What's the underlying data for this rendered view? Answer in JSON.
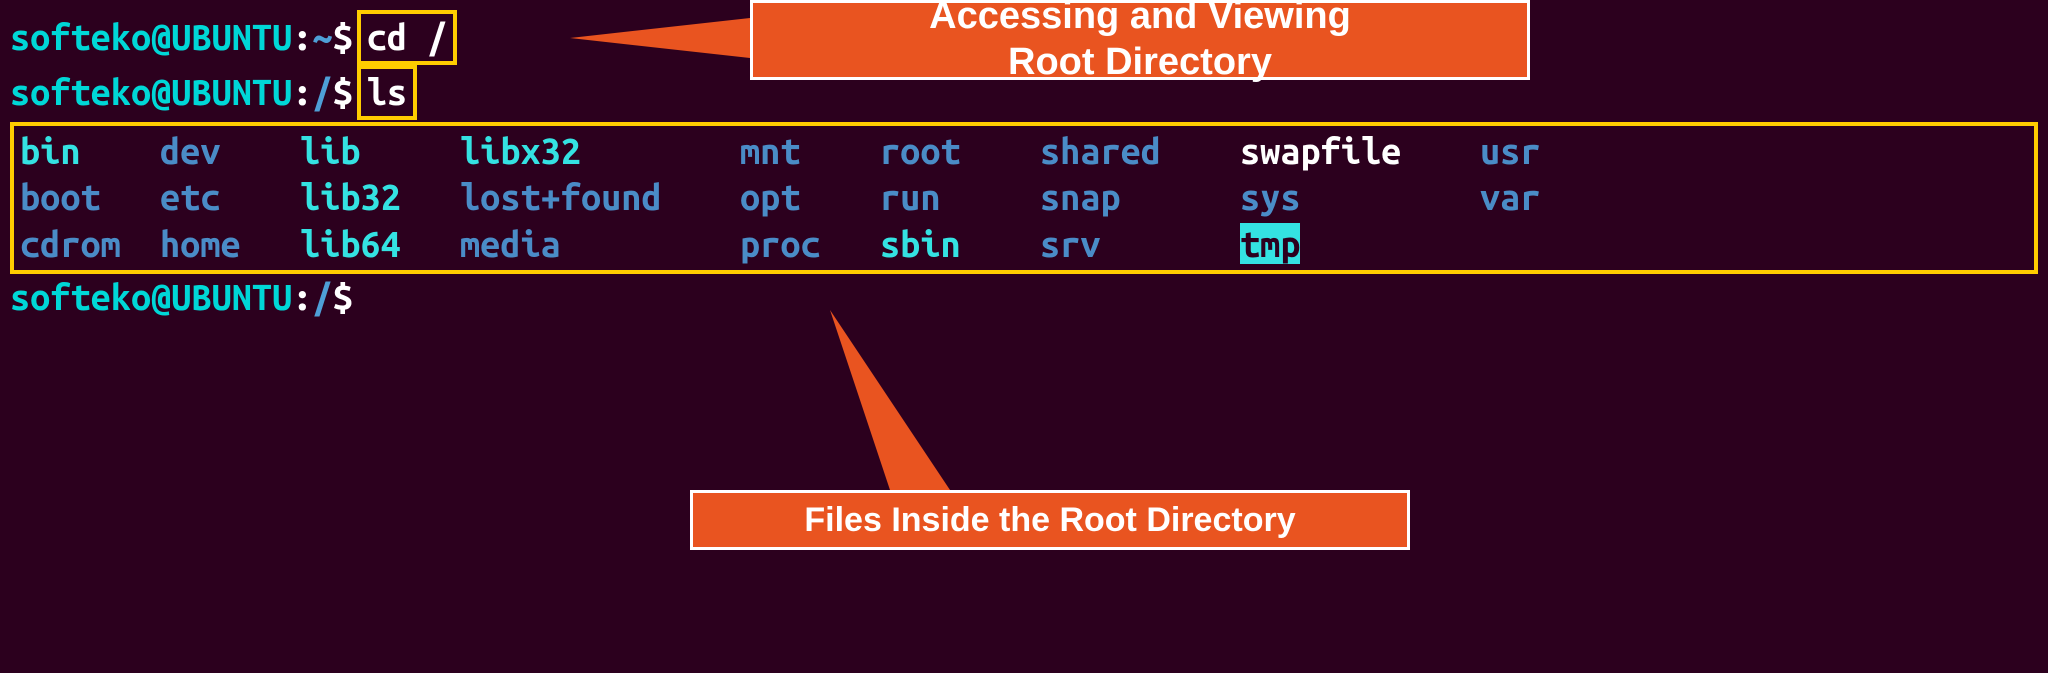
{
  "prompts": {
    "line1": {
      "user_host": "softeko@UBUNTU",
      "colon": ":",
      "path": "~",
      "dollar": "$ ",
      "command": "cd /"
    },
    "line2": {
      "user_host": "softeko@UBUNTU",
      "colon": ":",
      "path": "/",
      "dollar": "$ ",
      "command": "ls"
    },
    "line3": {
      "user_host": "softeko@UBUNTU",
      "colon": ":",
      "path": "/",
      "dollar": "$"
    }
  },
  "ls_output": {
    "row1": {
      "c1": {
        "text": "bin",
        "color": "cyan"
      },
      "c2": {
        "text": "dev",
        "color": "blue"
      },
      "c3": {
        "text": "lib",
        "color": "cyan"
      },
      "c4": {
        "text": "libx32",
        "color": "cyan"
      },
      "c5": {
        "text": "mnt",
        "color": "blue"
      },
      "c6": {
        "text": "root",
        "color": "blue"
      },
      "c7": {
        "text": "shared",
        "color": "blue"
      },
      "c8": {
        "text": "swapfile",
        "color": "white"
      },
      "c9": {
        "text": "usr",
        "color": "blue"
      }
    },
    "row2": {
      "c1": {
        "text": "boot",
        "color": "blue"
      },
      "c2": {
        "text": "etc",
        "color": "blue"
      },
      "c3": {
        "text": "lib32",
        "color": "cyan"
      },
      "c4": {
        "text": "lost+found",
        "color": "blue"
      },
      "c5": {
        "text": "opt",
        "color": "blue"
      },
      "c6": {
        "text": "run",
        "color": "blue"
      },
      "c7": {
        "text": "snap",
        "color": "blue"
      },
      "c8": {
        "text": "sys",
        "color": "blue"
      },
      "c9": {
        "text": "var",
        "color": "blue"
      }
    },
    "row3": {
      "c1": {
        "text": "cdrom",
        "color": "blue"
      },
      "c2": {
        "text": "home",
        "color": "blue"
      },
      "c3": {
        "text": "lib64",
        "color": "cyan"
      },
      "c4": {
        "text": "media",
        "color": "blue"
      },
      "c5": {
        "text": "proc",
        "color": "blue"
      },
      "c6": {
        "text": "sbin",
        "color": "cyan"
      },
      "c7": {
        "text": "srv",
        "color": "blue"
      },
      "c8": {
        "text": "tmp",
        "color": "highlight"
      },
      "c9": {
        "text": "",
        "color": "white"
      }
    }
  },
  "callouts": {
    "c1_line1": "Accessing and Viewing",
    "c1_line2": "Root Directory",
    "c2": "Files Inside the Root Directory"
  }
}
